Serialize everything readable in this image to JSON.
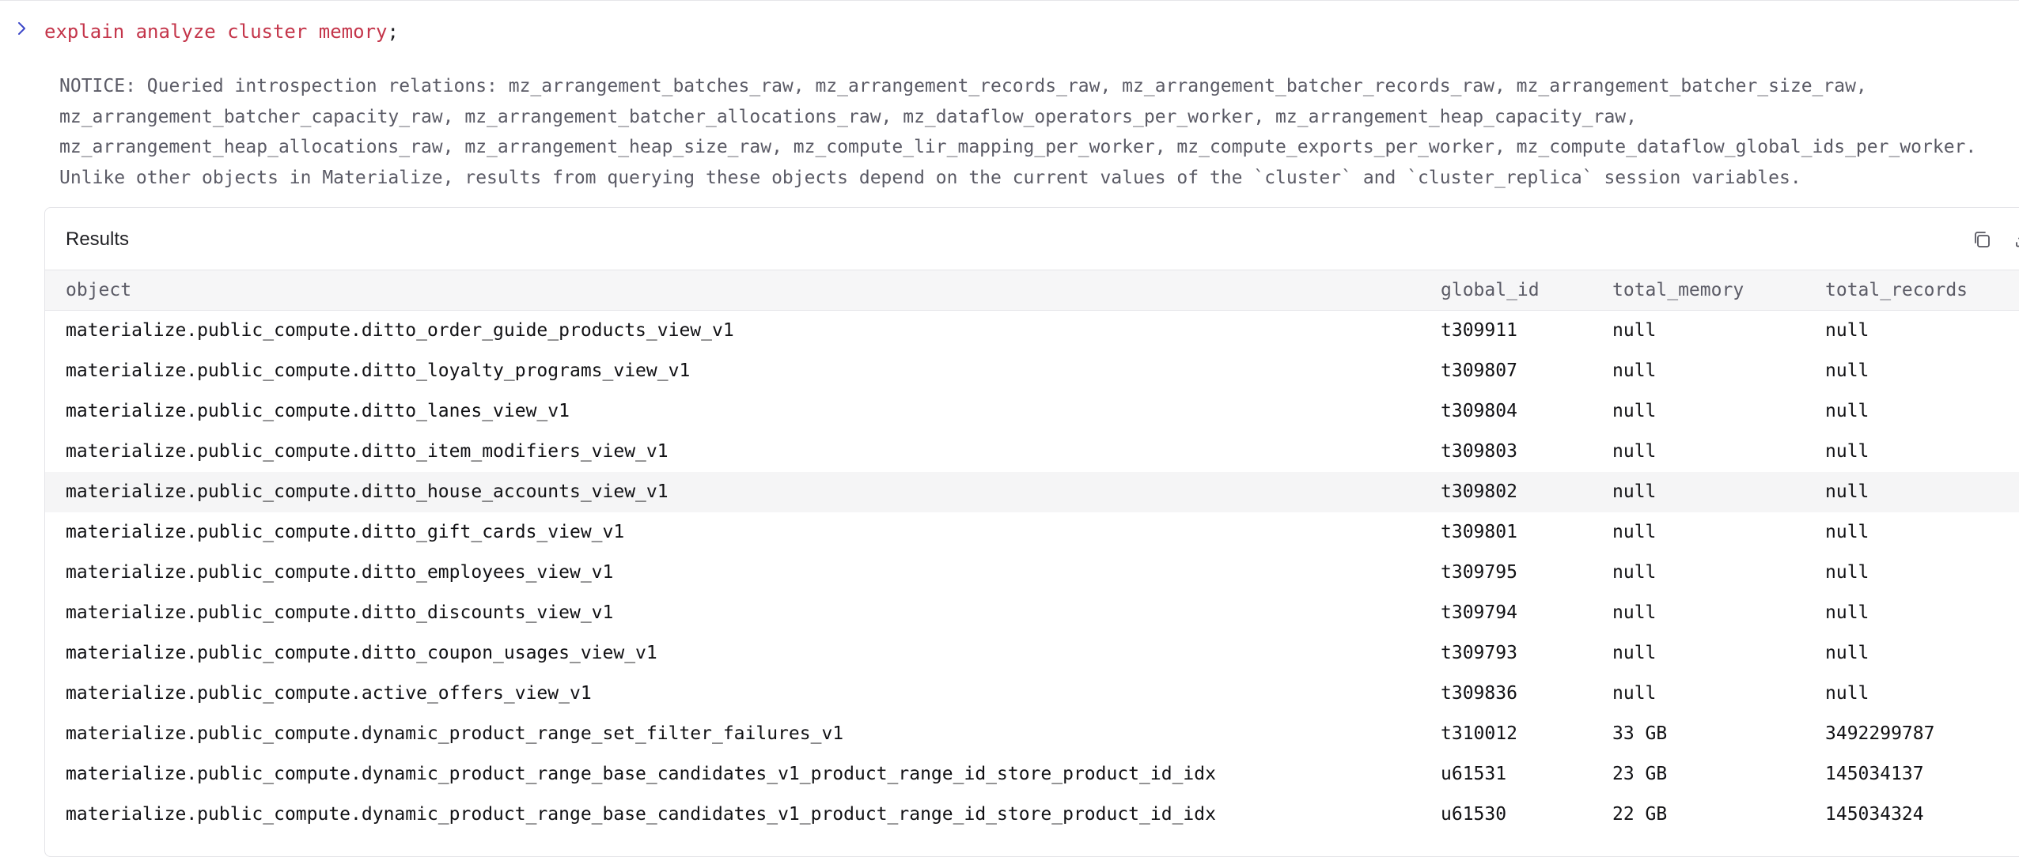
{
  "query": {
    "text": "explain analyze cluster memory",
    "terminator": ";"
  },
  "notice": "NOTICE: Queried introspection relations: mz_arrangement_batches_raw, mz_arrangement_records_raw, mz_arrangement_batcher_records_raw, mz_arrangement_batcher_size_raw, mz_arrangement_batcher_capacity_raw, mz_arrangement_batcher_allocations_raw, mz_dataflow_operators_per_worker, mz_arrangement_heap_capacity_raw, mz_arrangement_heap_allocations_raw, mz_arrangement_heap_size_raw, mz_compute_lir_mapping_per_worker, mz_compute_exports_per_worker, mz_compute_dataflow_global_ids_per_worker. Unlike other objects in Materialize, results from querying these objects depend on the current values of the `cluster` and `cluster_replica` session variables.",
  "results": {
    "title": "Results",
    "icons": [
      "copy-icon",
      "download-icon"
    ],
    "columns": [
      "object",
      "global_id",
      "total_memory",
      "total_records"
    ],
    "rows": [
      [
        "materialize.public_compute.ditto_order_guide_products_view_v1",
        "t309911",
        "null",
        "null"
      ],
      [
        "materialize.public_compute.ditto_loyalty_programs_view_v1",
        "t309807",
        "null",
        "null"
      ],
      [
        "materialize.public_compute.ditto_lanes_view_v1",
        "t309804",
        "null",
        "null"
      ],
      [
        "materialize.public_compute.ditto_item_modifiers_view_v1",
        "t309803",
        "null",
        "null"
      ],
      [
        "materialize.public_compute.ditto_house_accounts_view_v1",
        "t309802",
        "null",
        "null"
      ],
      [
        "materialize.public_compute.ditto_gift_cards_view_v1",
        "t309801",
        "null",
        "null"
      ],
      [
        "materialize.public_compute.ditto_employees_view_v1",
        "t309795",
        "null",
        "null"
      ],
      [
        "materialize.public_compute.ditto_discounts_view_v1",
        "t309794",
        "null",
        "null"
      ],
      [
        "materialize.public_compute.ditto_coupon_usages_view_v1",
        "t309793",
        "null",
        "null"
      ],
      [
        "materialize.public_compute.active_offers_view_v1",
        "t309836",
        "null",
        "null"
      ],
      [
        "materialize.public_compute.dynamic_product_range_set_filter_failures_v1",
        "t310012",
        "33 GB",
        "3492299787"
      ],
      [
        "materialize.public_compute.dynamic_product_range_base_candidates_v1_product_range_id_store_product_id_idx",
        "u61531",
        "23 GB",
        "145034137"
      ],
      [
        "materialize.public_compute.dynamic_product_range_base_candidates_v1_product_range_id_store_product_id_idx",
        "u61530",
        "22 GB",
        "145034324"
      ]
    ],
    "highlighted_row": 4
  },
  "colors": {
    "query": "#c4354a",
    "chevron": "#3b46c8"
  }
}
